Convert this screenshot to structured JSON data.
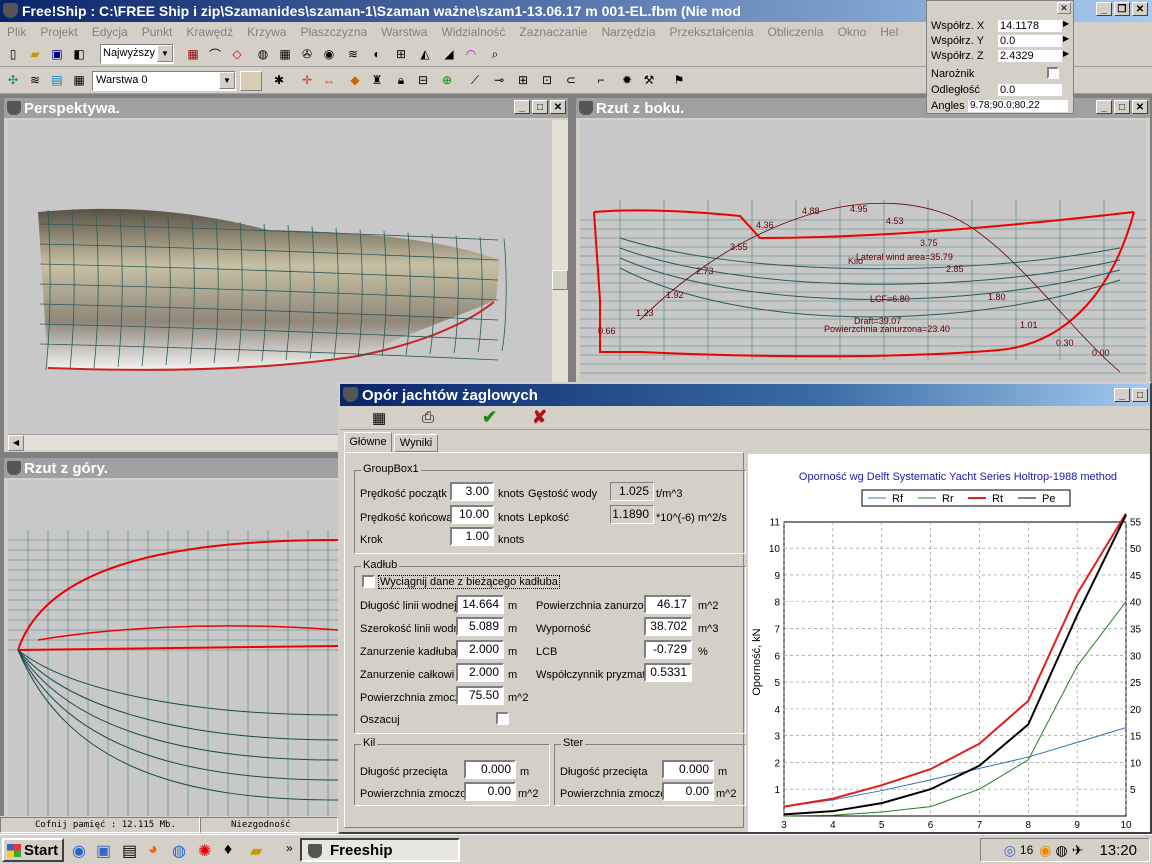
{
  "app": {
    "title": "Free!Ship  : C:\\FREE Ship i zip\\Szamanides\\szaman-1\\Szaman  ważne\\szam1-13.06.17 m 001-EL.fbm (Nie mod",
    "menu": [
      "Plik",
      "Projekt",
      "Edycja",
      "Punkt",
      "Krawędź",
      "Krzywa",
      "Płaszczyzna",
      "Warstwa",
      "Widzialność",
      "Zaznaczanie",
      "Narzędzia",
      "Przekształcenia",
      "Obliczenia",
      "Okno",
      "Hel"
    ],
    "combo_precision": "Najwyższy",
    "combo_layer": "Warstwa 0"
  },
  "coord_panel": {
    "x_label": "Współrz. X",
    "x_value": "14.1178",
    "y_label": "Współrz. Y",
    "y_value": "0.0",
    "z_label": "Współrz. Z",
    "z_value": "2.4329",
    "corner_label": "Narożnik",
    "distance_label": "Odległość",
    "distance_value": "0.0",
    "angles_label": "Angles",
    "angles_value": "9.78;90.0;80.22"
  },
  "views": {
    "perspective": "Perspektywa.",
    "side": "Rzut z boku.",
    "top": "Rzut z góry."
  },
  "side_labels": [
    "4.36",
    "4.88",
    "4.95",
    "4.53",
    "3.55",
    "3.75",
    "2.73",
    "2.85",
    "1.92",
    "1.80",
    "1.23",
    "1.01",
    "0.66",
    "0.30",
    "0.00"
  ],
  "side_annotations": {
    "lateral": "Lateral wind area=35.79",
    "lcf": "LCF=6.80",
    "draft": "Draft=39.07",
    "wetted": "Powierzchnia zanurzona=23.40",
    "kilo": "Kilo"
  },
  "status": {
    "memory": "Cofnij pamięć : 12.115 Mb.",
    "tolerance": "Niezgodność odległośc"
  },
  "dialog": {
    "title": "Opór jachtów żaglowych",
    "tabs": [
      "Główne",
      "Wyniki"
    ],
    "group1": {
      "title": "GroupBox1",
      "speed_start_label": "Prędkość początk",
      "speed_start": "3.00",
      "unit_knots": "knots",
      "density_label": "Gęstość wody",
      "density": "1.025",
      "density_unit": "t/m^3",
      "speed_end_label": "Prędkość końcowa",
      "speed_end": "10.00",
      "viscosity_label": "Lepkość",
      "viscosity": "1.1890",
      "viscosity_unit": "*10^(-6) m^2/s",
      "step_label": "Krok",
      "step": "1.00"
    },
    "hull": {
      "title": "Kadłub",
      "extract_label": "Wyciągnij dane z bieżącego kadłuba",
      "lwl_label": "Długość linii wodnej",
      "lwl": "14.664",
      "bwl_label": "Szerokość linii wodn",
      "bwl": "5.089",
      "draft_label": "Zanurzenie kadłuba",
      "draft": "2.000",
      "total_draft_label": "Zanurzenie całkowi",
      "total_draft": "2.000",
      "wetted_label": "Powierzchnia zmocz",
      "wetted": "75.50",
      "estimate_label": "Oszacuj",
      "immersed_label": "Powierzchnia zanurzon",
      "immersed": "46.17",
      "displacement_label": "Wyporność",
      "displacement": "38.702",
      "lcb_label": "LCB",
      "lcb": "-0.729",
      "prismatic_label": "Współczynnik pryzmat",
      "prismatic": "0.5331",
      "unit_m": "m",
      "unit_m2": "m^2",
      "unit_m3": "m^3",
      "unit_pct": "%"
    },
    "keel": {
      "title": "Kil",
      "chord_label": "Długość przecięta",
      "chord": "0.000",
      "area_label": "Powierzchnia zmoczon",
      "area": "0.00"
    },
    "rudder": {
      "title": "Ster",
      "chord_label": "Długość przecięta",
      "chord": "0.000",
      "area_label": "Powierzchnia zmoczon",
      "area": "0.00"
    }
  },
  "taskbar": {
    "start": "Start",
    "task": "Freeship",
    "tray_num": "16",
    "clock": "13:20"
  },
  "chart_data": {
    "type": "line",
    "title": "Oporność wg Delft Systematic Yacht Series Holtrop-1988 method",
    "xlabel": "",
    "ylabel": "Oporność, kN",
    "x": [
      3,
      4,
      5,
      6,
      7,
      8,
      9,
      10
    ],
    "xlim": [
      3,
      10
    ],
    "ylim": [
      0,
      11.5
    ],
    "y2lim": [
      0,
      57.5
    ],
    "yticks": [
      1,
      2,
      3,
      4,
      5,
      6,
      7,
      8,
      9,
      10,
      11
    ],
    "y2ticks": [
      5,
      10,
      15,
      20,
      25,
      30,
      35,
      40,
      45,
      50,
      55
    ],
    "grid": true,
    "legend_position": "top",
    "series": [
      {
        "name": "Rf",
        "color": "#3070c0",
        "axis": "left",
        "values": [
          0.35,
          0.6,
          0.95,
          1.35,
          1.78,
          2.2,
          2.75,
          3.3
        ]
      },
      {
        "name": "Rr",
        "color": "#208020",
        "axis": "left",
        "values": [
          0.0,
          0.03,
          0.15,
          0.35,
          1.0,
          2.1,
          5.6,
          8.0
        ]
      },
      {
        "name": "Rt",
        "color": "#e02020",
        "axis": "left",
        "values": [
          0.35,
          0.65,
          1.15,
          1.75,
          2.7,
          4.3,
          8.3,
          11.3
        ]
      },
      {
        "name": "Pe",
        "color": "#000000",
        "axis": "right",
        "values": [
          0.3,
          0.9,
          2.4,
          5.0,
          9.4,
          17.1,
          37.5,
          56.2
        ]
      }
    ]
  }
}
